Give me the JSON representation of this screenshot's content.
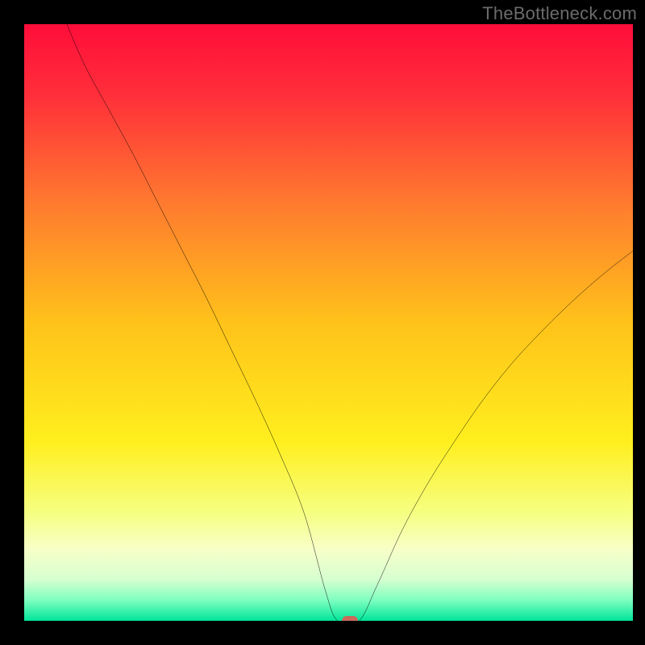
{
  "watermark": "TheBottleneck.com",
  "chart_data": {
    "type": "line",
    "title": "",
    "xlabel": "",
    "ylabel": "",
    "xlim": [
      0,
      100
    ],
    "ylim": [
      0,
      100
    ],
    "background_gradient": {
      "stops": [
        {
          "pos": 0.0,
          "color": "#ff0d3a"
        },
        {
          "pos": 0.12,
          "color": "#ff2f3a"
        },
        {
          "pos": 0.3,
          "color": "#ff7a2f"
        },
        {
          "pos": 0.5,
          "color": "#ffc21a"
        },
        {
          "pos": 0.7,
          "color": "#ffef1e"
        },
        {
          "pos": 0.82,
          "color": "#f6ff82"
        },
        {
          "pos": 0.88,
          "color": "#f7ffc8"
        },
        {
          "pos": 0.93,
          "color": "#d7ffd0"
        },
        {
          "pos": 0.965,
          "color": "#7fffc0"
        },
        {
          "pos": 1.0,
          "color": "#00e49a"
        }
      ]
    },
    "series": [
      {
        "name": "bottleneck-curve",
        "x": [
          7,
          10,
          14,
          18,
          22,
          26,
          30,
          34,
          38,
          42,
          46,
          49.5,
          51.5,
          55,
          58,
          62,
          66,
          70,
          75,
          80,
          85,
          90,
          95,
          100
        ],
        "y": [
          100,
          93,
          85.5,
          78,
          70,
          62,
          54,
          45.5,
          37,
          28,
          18,
          5,
          0,
          0,
          6,
          15,
          22.5,
          29,
          36.5,
          43,
          48.5,
          53.5,
          58,
          62
        ]
      }
    ],
    "marker": {
      "x": 53.5,
      "y": 0,
      "color": "#c96a5b"
    }
  }
}
